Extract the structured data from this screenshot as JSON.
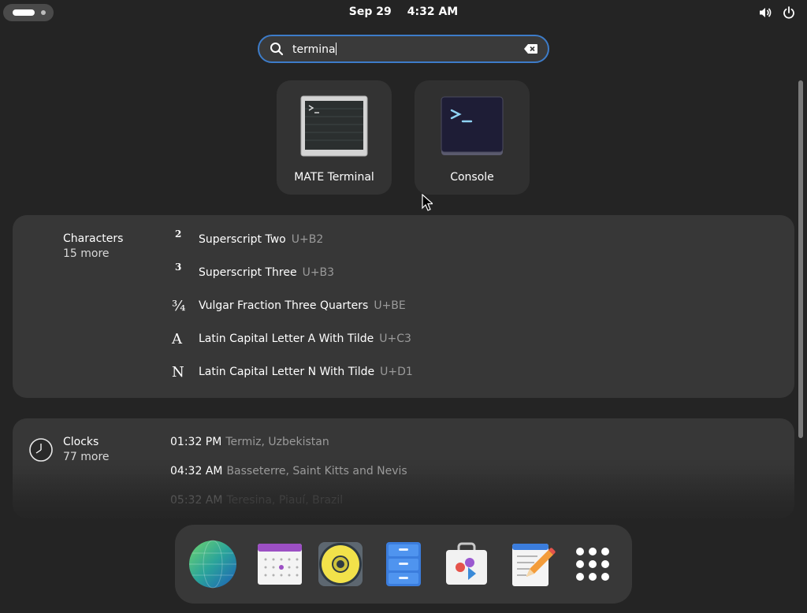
{
  "topbar": {
    "date": "Sep 29",
    "time": "4:32 AM",
    "icons": [
      "activities-indicator",
      "volume-icon",
      "power-icon"
    ]
  },
  "search": {
    "value": "termina",
    "icons": [
      "search-icon",
      "clear-icon"
    ]
  },
  "apps": [
    {
      "label": "MATE Terminal",
      "icon": "mate-terminal-icon"
    },
    {
      "label": "Console",
      "icon": "console-icon"
    }
  ],
  "characters": {
    "title": "Characters",
    "more": "15 more",
    "items": [
      {
        "glyph": "2",
        "name": "Superscript Two",
        "code": "U+B2"
      },
      {
        "glyph": "3",
        "name": "Superscript Three",
        "code": "U+B3"
      },
      {
        "glyph": "¾",
        "name": "Vulgar Fraction Three Quarters",
        "code": "U+BE"
      },
      {
        "glyph": "A",
        "name": "Latin Capital Letter A With Tilde",
        "code": "U+C3"
      },
      {
        "glyph": "N",
        "name": "Latin Capital Letter N With Tilde",
        "code": "U+D1"
      }
    ]
  },
  "clocks": {
    "title": "Clocks",
    "more": "77 more",
    "items": [
      {
        "time": "01:32 PM",
        "place": "Termiz, Uzbekistan"
      },
      {
        "time": "04:32 AM",
        "place": "Basseterre, Saint Kitts and Nevis"
      },
      {
        "time": "05:32 AM",
        "place": "Teresina, Piauí, Brazil"
      }
    ]
  },
  "dock": {
    "items": [
      "globe-browser-icon",
      "calendar-icon",
      "rhythmbox-speaker-icon",
      "files-cabinet-icon",
      "software-bag-icon",
      "text-editor-icon",
      "app-grid-icon"
    ]
  },
  "colors": {
    "background": "#242424",
    "accent": "#3d7cc9",
    "panel": "#373737"
  }
}
